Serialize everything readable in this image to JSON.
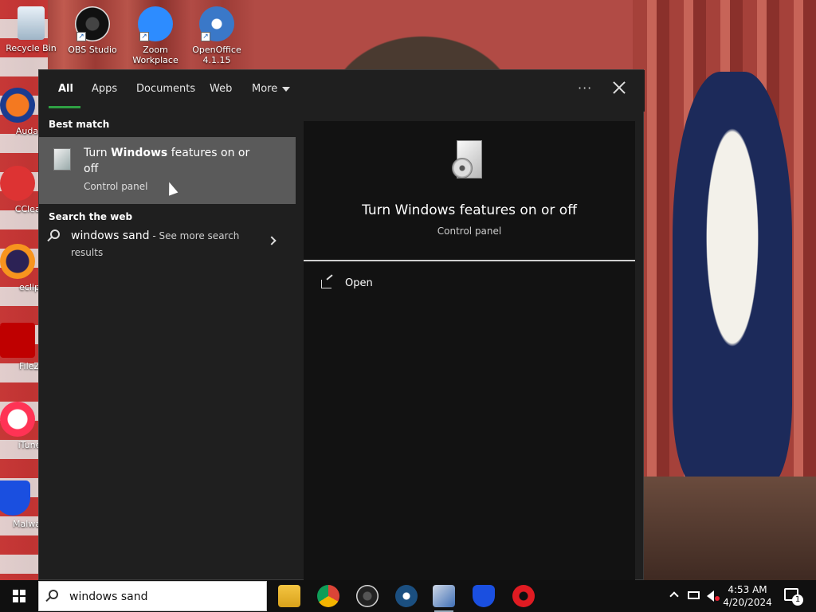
{
  "desktop": {
    "icons": [
      {
        "label": "Recycle Bin"
      },
      {
        "label": "OBS Studio"
      },
      {
        "label": "Zoom Workplace"
      },
      {
        "label": "OpenOffice 4.1.15"
      },
      {
        "label": "Audac"
      },
      {
        "label": "CClear"
      },
      {
        "label": "eclip"
      },
      {
        "label": "FileZ"
      },
      {
        "label": "iTune"
      },
      {
        "label": "Malware"
      }
    ]
  },
  "search_panel": {
    "tabs": [
      {
        "label": "All"
      },
      {
        "label": "Apps"
      },
      {
        "label": "Documents"
      },
      {
        "label": "Web"
      },
      {
        "label": "More"
      }
    ],
    "ellipsis": "···",
    "best_match": {
      "section_title": "Best match",
      "title_pre": "Turn ",
      "title_bold": "Windows",
      "title_post": " features on or off",
      "subtitle": "Control panel"
    },
    "web": {
      "section_title": "Search the web",
      "query": "windows sand",
      "more": " - See more search results"
    },
    "detail": {
      "title": "Turn Windows features on or off",
      "subtitle": "Control panel",
      "open_label": "Open"
    }
  },
  "taskbar": {
    "search_value": "windows sand",
    "clock_time": "4:53 AM",
    "clock_date": "4/20/2024",
    "notification_count": "1",
    "apps": [
      "file-explorer",
      "chrome",
      "obs",
      "steam",
      "remote-desktop",
      "malwarebytes",
      "opera"
    ]
  },
  "colors": {
    "panel_bg": "#1f1f1f",
    "selected_bg": "#5a5a5a",
    "accent": "#2ea043"
  }
}
